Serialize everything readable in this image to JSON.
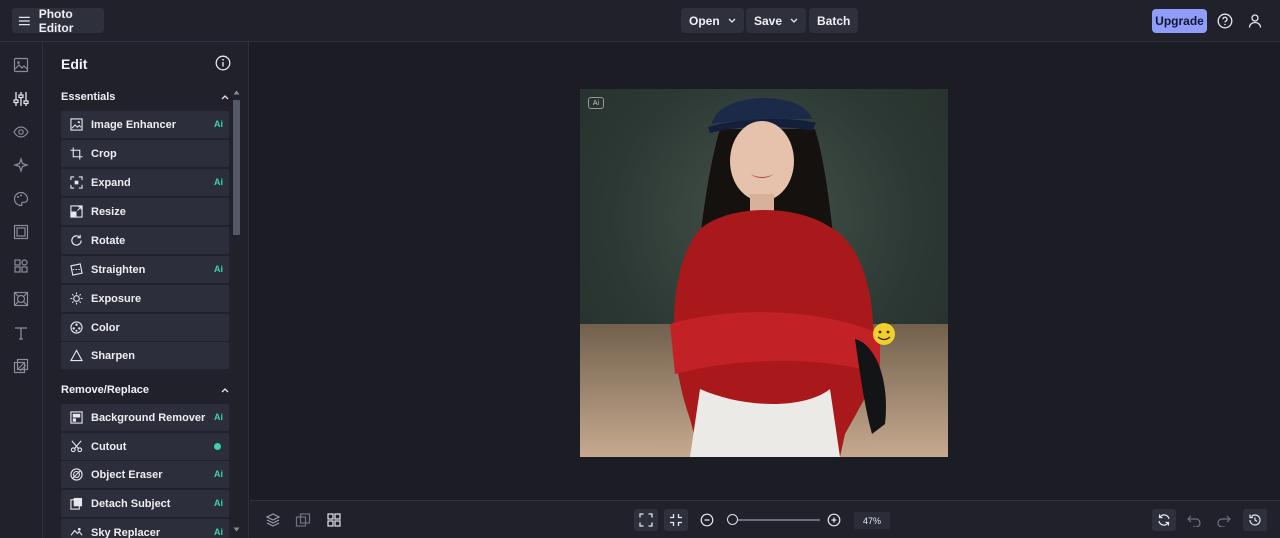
{
  "app": {
    "title": "Photo Editor"
  },
  "top_menu": {
    "open": "Open",
    "save": "Save",
    "batch": "Batch",
    "upgrade": "Upgrade"
  },
  "panel": {
    "title": "Edit",
    "sections": [
      {
        "title": "Essentials",
        "items": [
          {
            "label": "Image Enhancer",
            "icon": "image-enhancer-icon",
            "badge": "Ai"
          },
          {
            "label": "Crop",
            "icon": "crop-icon",
            "badge": ""
          },
          {
            "label": "Expand",
            "icon": "expand-icon",
            "badge": "Ai"
          },
          {
            "label": "Resize",
            "icon": "resize-icon",
            "badge": ""
          },
          {
            "label": "Rotate",
            "icon": "rotate-icon",
            "badge": ""
          },
          {
            "label": "Straighten",
            "icon": "straighten-icon",
            "badge": "Ai"
          },
          {
            "label": "Exposure",
            "icon": "exposure-icon",
            "badge": ""
          },
          {
            "label": "Color",
            "icon": "color-icon",
            "badge": ""
          },
          {
            "label": "Sharpen",
            "icon": "sharpen-icon",
            "badge": ""
          }
        ]
      },
      {
        "title": "Remove/Replace",
        "items": [
          {
            "label": "Background Remover",
            "icon": "background-remover-icon",
            "badge": "Ai"
          },
          {
            "label": "Cutout",
            "icon": "cutout-icon",
            "badge": "dot"
          },
          {
            "label": "Object Eraser",
            "icon": "object-eraser-icon",
            "badge": "Ai"
          },
          {
            "label": "Detach Subject",
            "icon": "detach-subject-icon",
            "badge": "Ai"
          },
          {
            "label": "Sky Replacer",
            "icon": "sky-replacer-icon",
            "badge": "Ai"
          }
        ]
      }
    ]
  },
  "canvas": {
    "ai_chip": "Ai",
    "image_alt": "Woman in navy cap and red knit sweater"
  },
  "zoom": {
    "value": "47%",
    "fraction": 0.06
  },
  "colors": {
    "accent": "#8f9cf8",
    "ai_badge": "#3fd2a6",
    "background": "#1c1c24",
    "panel": "#20212b",
    "tool_item": "#2c2e3b"
  }
}
